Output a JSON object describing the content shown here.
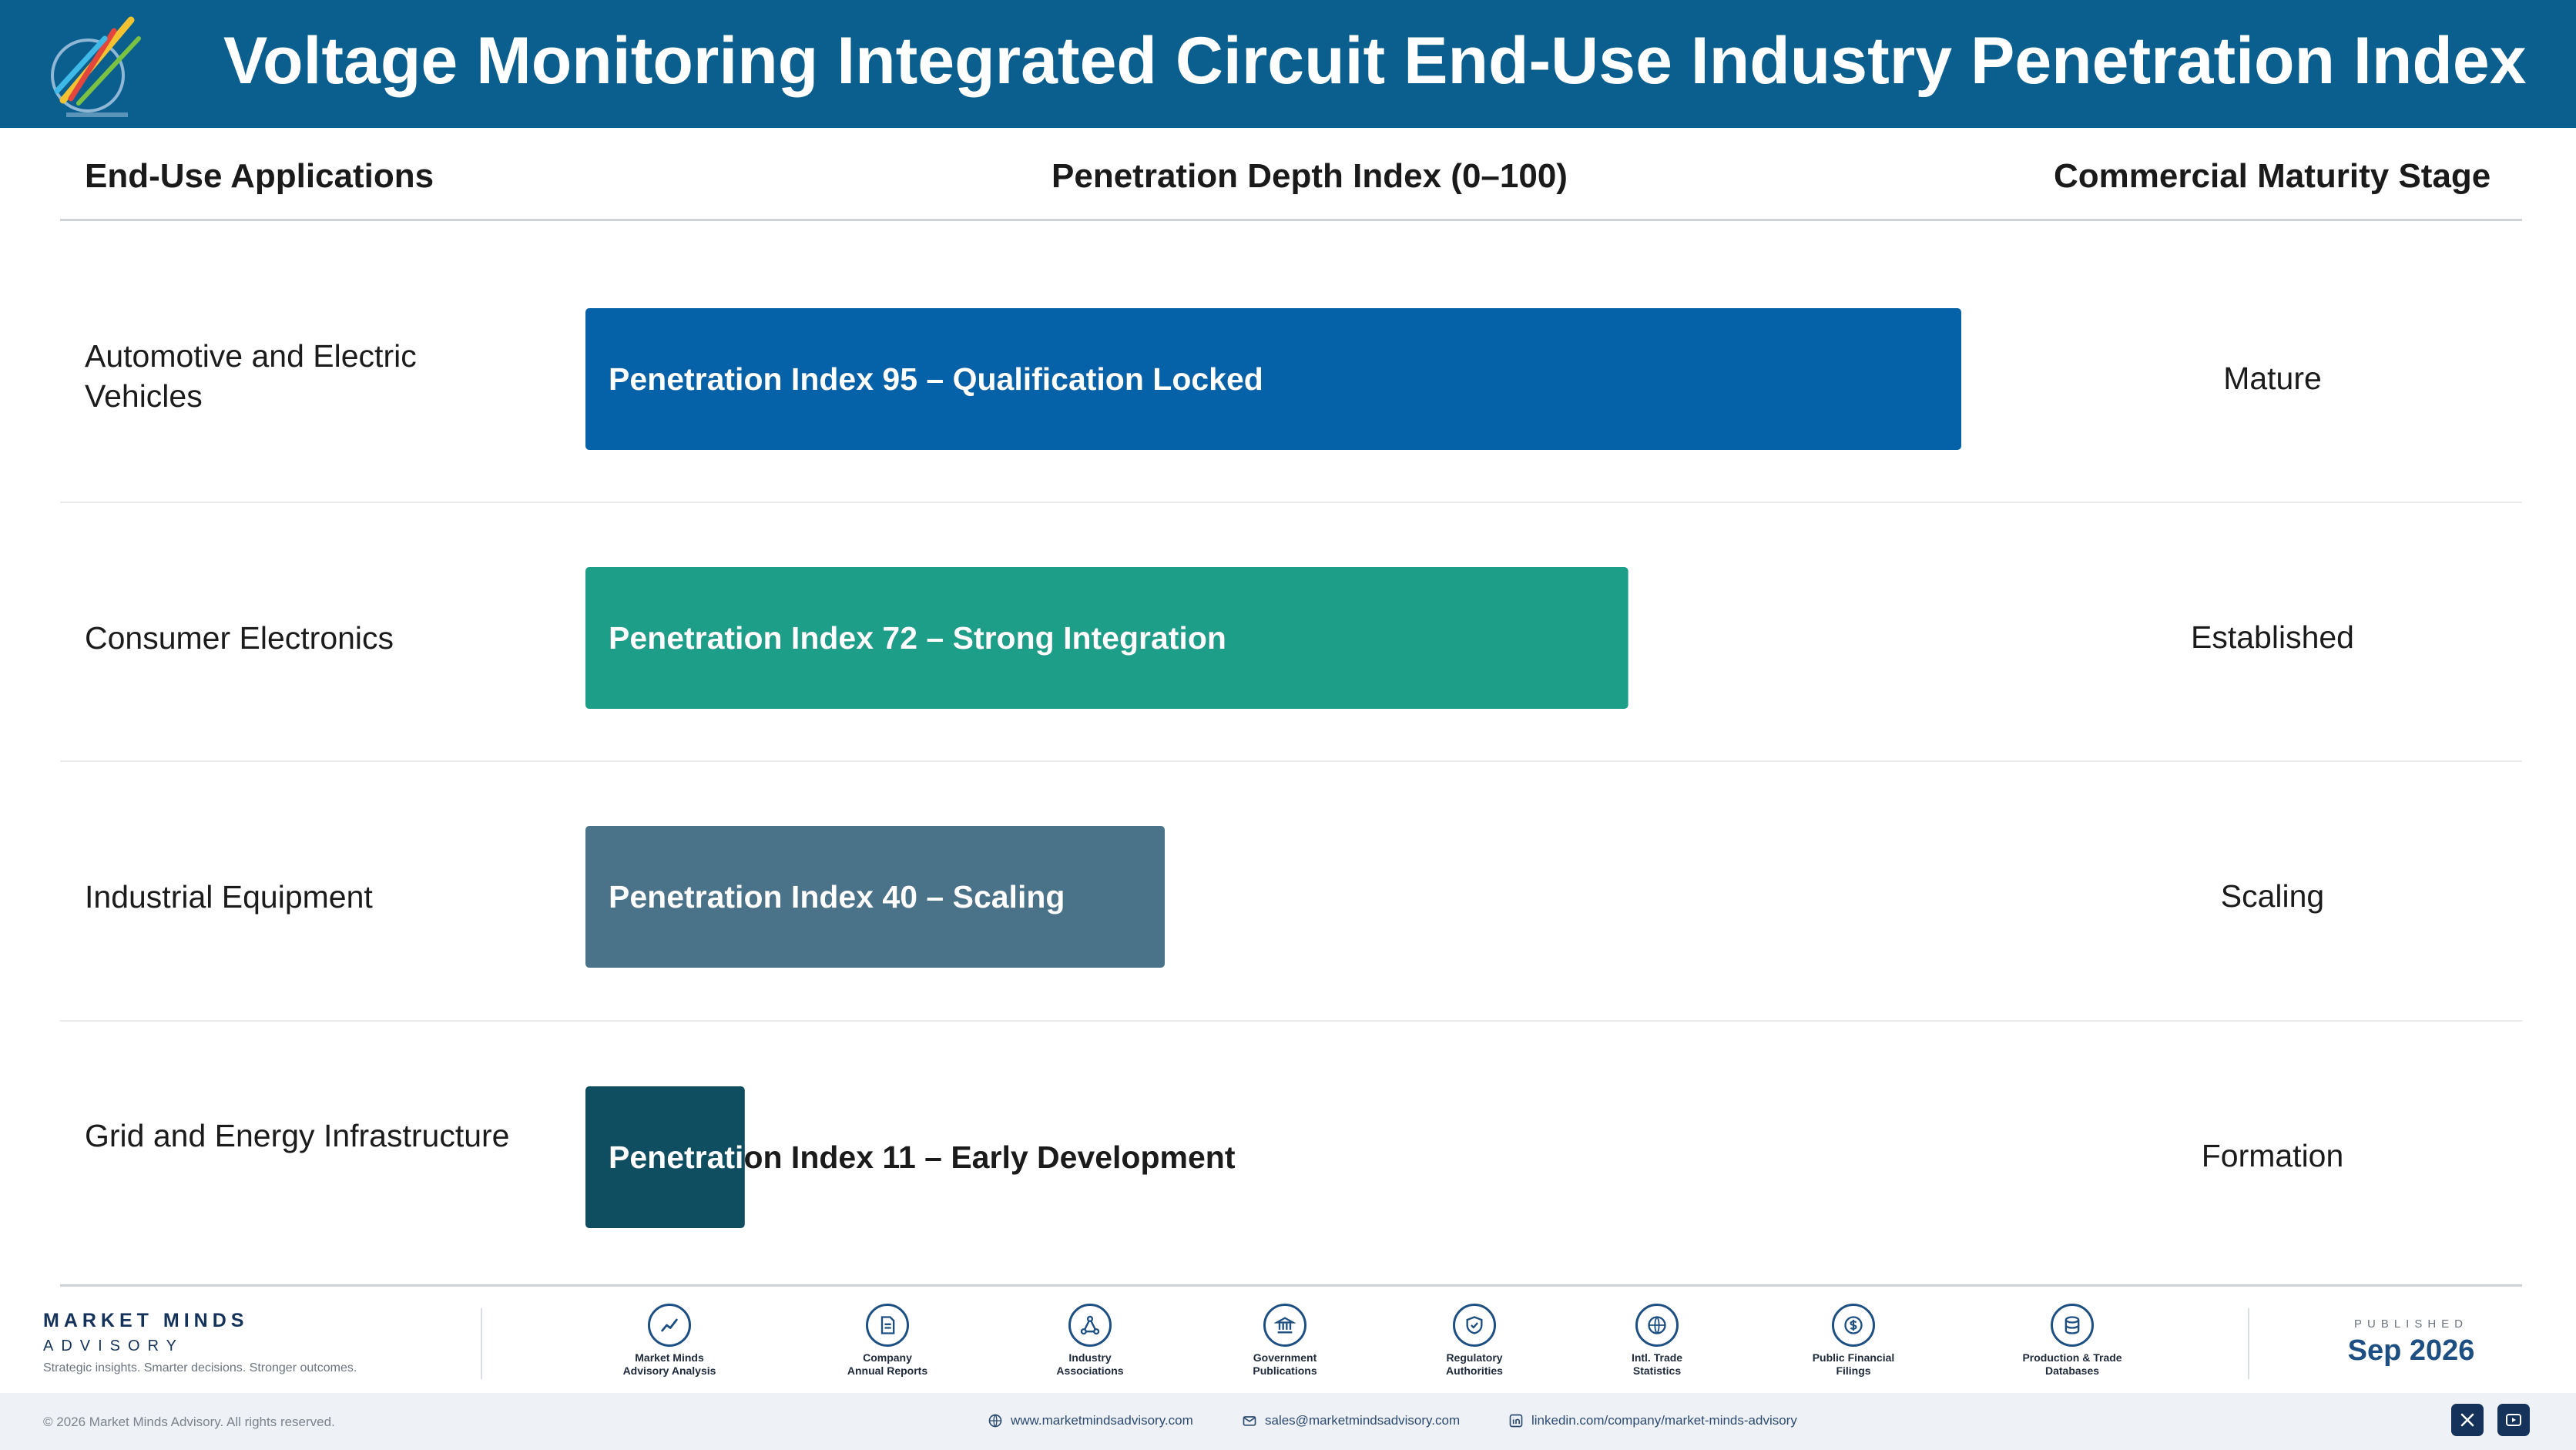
{
  "header": {
    "title": "Voltage Monitoring Integrated Circuit End-Use Industry Penetration Index",
    "logo_text": "Market Minds Advisory"
  },
  "columns": {
    "applications": "End-Use Applications",
    "depth": "Penetration Depth Index (0–100)",
    "stage": "Commercial Maturity Stage"
  },
  "rows": [
    {
      "label": "Automotive and Electric Vehicles",
      "stage": "Mature"
    },
    {
      "label": "Consumer Electronics",
      "stage": "Established"
    },
    {
      "label": "Industrial Equipment",
      "stage": "Scaling"
    },
    {
      "label": "Grid and Energy Infrastructure",
      "stage": "Formation"
    }
  ],
  "chart_data": {
    "type": "bar",
    "orientation": "horizontal",
    "categories": [
      "Automotive and Electric Vehicles",
      "Consumer Electronics",
      "Industrial Equipment",
      "Grid and Energy Infrastructure"
    ],
    "values": [
      95,
      72,
      40,
      11
    ],
    "data_labels": [
      "Penetration Index 95 – Qualification Locked",
      "Penetration Index 72 – Strong Integration",
      "Penetration Index 40 – Scaling",
      "Penetration Index 11 – Early Development"
    ],
    "colors": [
      "#0562a8",
      "#1c9e89",
      "#4a7289",
      "#0e4e60"
    ],
    "xlim": [
      0,
      100
    ],
    "grid": false,
    "title": "Penetration Depth Index (0–100)"
  },
  "footer": {
    "brand_name": "MARKET MINDS",
    "brand_sub": "ADVISORY",
    "tagline": "Strategic insights. Smarter decisions. Stronger outcomes.",
    "sources": [
      {
        "label": "Market Minds\nAdvisory Analysis",
        "icon": "chart-line-icon"
      },
      {
        "label": "Company\nAnnual Reports",
        "icon": "document-icon"
      },
      {
        "label": "Industry\nAssociations",
        "icon": "network-icon"
      },
      {
        "label": "Government\nPublications",
        "icon": "bank-icon"
      },
      {
        "label": "Regulatory\nAuthorities",
        "icon": "shield-icon"
      },
      {
        "label": "Intl. Trade\nStatistics",
        "icon": "globe-icon"
      },
      {
        "label": "Public Financial\nFilings",
        "icon": "dollar-icon"
      },
      {
        "label": "Production & Trade\nDatabases",
        "icon": "database-icon"
      }
    ],
    "published_caption": "PUBLISHED",
    "published_date": "Sep 2026",
    "copyright": "© 2026 Market Minds Advisory. All rights reserved.",
    "website": "www.marketmindsadvisory.com",
    "email": "sales@marketmindsadvisory.com",
    "linkedin": "linkedin.com/company/market-minds-advisory"
  }
}
